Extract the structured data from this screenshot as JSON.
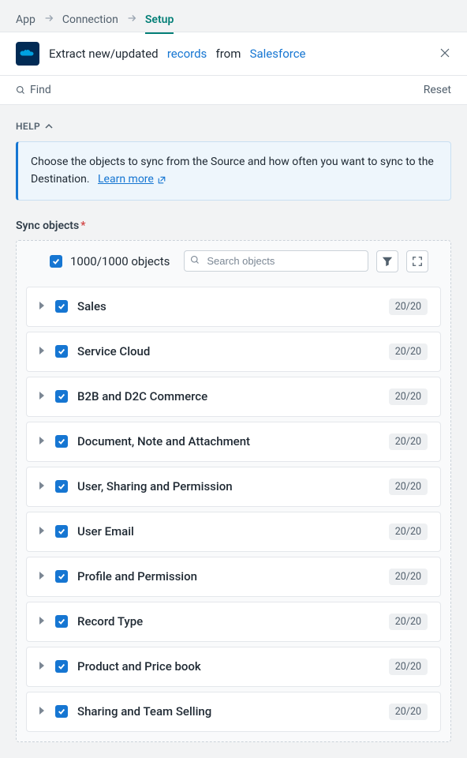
{
  "breadcrumb": {
    "items": [
      "App",
      "Connection",
      "Setup"
    ],
    "activeIndex": 2
  },
  "title": {
    "prefix": "Extract new/updated",
    "linkRecords": "records",
    "middle": "from",
    "linkSource": "Salesforce"
  },
  "toolbar": {
    "find": "Find",
    "reset": "Reset"
  },
  "help": {
    "label": "HELP",
    "text": "Choose the objects to sync from the Source and how often you want to sync to the Destination.",
    "learn": "Learn more"
  },
  "syncSection": {
    "label": "Sync objects",
    "required": "*",
    "allCount": "1000/1000 objects",
    "searchPlaceholder": "Search objects"
  },
  "objects": [
    {
      "name": "Sales",
      "count": "20/20"
    },
    {
      "name": "Service Cloud",
      "count": "20/20"
    },
    {
      "name": "B2B and D2C Commerce",
      "count": "20/20"
    },
    {
      "name": "Document, Note and Attachment",
      "count": "20/20"
    },
    {
      "name": "User, Sharing and Permission",
      "count": "20/20"
    },
    {
      "name": "User Email",
      "count": "20/20"
    },
    {
      "name": "Profile and Permission",
      "count": "20/20"
    },
    {
      "name": "Record Type",
      "count": "20/20"
    },
    {
      "name": "Product and Price book",
      "count": "20/20"
    },
    {
      "name": "Sharing and Team Selling",
      "count": "20/20"
    }
  ]
}
